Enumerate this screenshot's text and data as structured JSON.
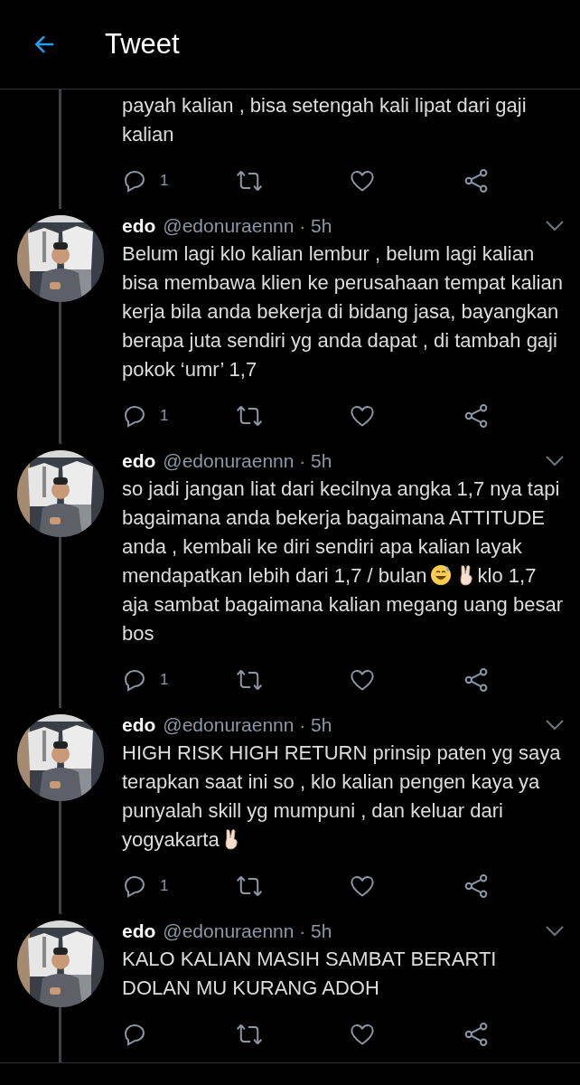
{
  "header": {
    "title": "Tweet"
  },
  "tweets": [
    {
      "kind": "partial",
      "body": [
        {
          "kind": "text",
          "text": "payah kalian , bisa setengah kali lipat dari gaji kalian"
        }
      ],
      "reply_count": "1"
    },
    {
      "kind": "full",
      "name": "edo",
      "handle_time": "@edonuraennn · 5h",
      "body": [
        {
          "kind": "text",
          "text": "Belum lagi klo kalian lembur , belum lagi kalian bisa membawa klien ke perusahaan tempat kalian kerja bila anda bekerja di bidang jasa, bayangkan berapa juta sendiri yg anda dapat , di tambah gaji pokok ‘umr’ 1,7"
        }
      ],
      "reply_count": "1"
    },
    {
      "kind": "full",
      "name": "edo",
      "handle_time": "@edonuraennn · 5h",
      "body": [
        {
          "kind": "text",
          "text": "so jadi jangan liat dari kecilnya angka 1,7 nya tapi bagaimana anda bekerja bagaimana ATTITUDE anda , kembali ke diri sendiri apa kalian layak mendapatkan lebih dari 1,7 / bulan"
        },
        {
          "kind": "sweat_smile"
        },
        {
          "kind": "victory"
        },
        {
          "kind": "text",
          "text": "klo 1,7 aja sambat bagaimana kalian megang uang besar bos"
        }
      ],
      "reply_count": "1"
    },
    {
      "kind": "full",
      "name": "edo",
      "handle_time": "@edonuraennn · 5h",
      "body": [
        {
          "kind": "text",
          "text": "HIGH RISK HIGH RETURN prinsip paten yg saya terapkan saat ini so , klo kalian pengen kaya ya punyalah skill yg mumpuni , dan keluar dari yogyakarta"
        },
        {
          "kind": "victory"
        }
      ],
      "reply_count": "1"
    },
    {
      "kind": "full",
      "name": "edo",
      "handle_time": "@edonuraennn · 5h",
      "body": [
        {
          "kind": "text",
          "text": "KALO KALIAN MASIH SAMBAT BERARTI DOLAN MU KURANG ADOH"
        }
      ]
    }
  ]
}
